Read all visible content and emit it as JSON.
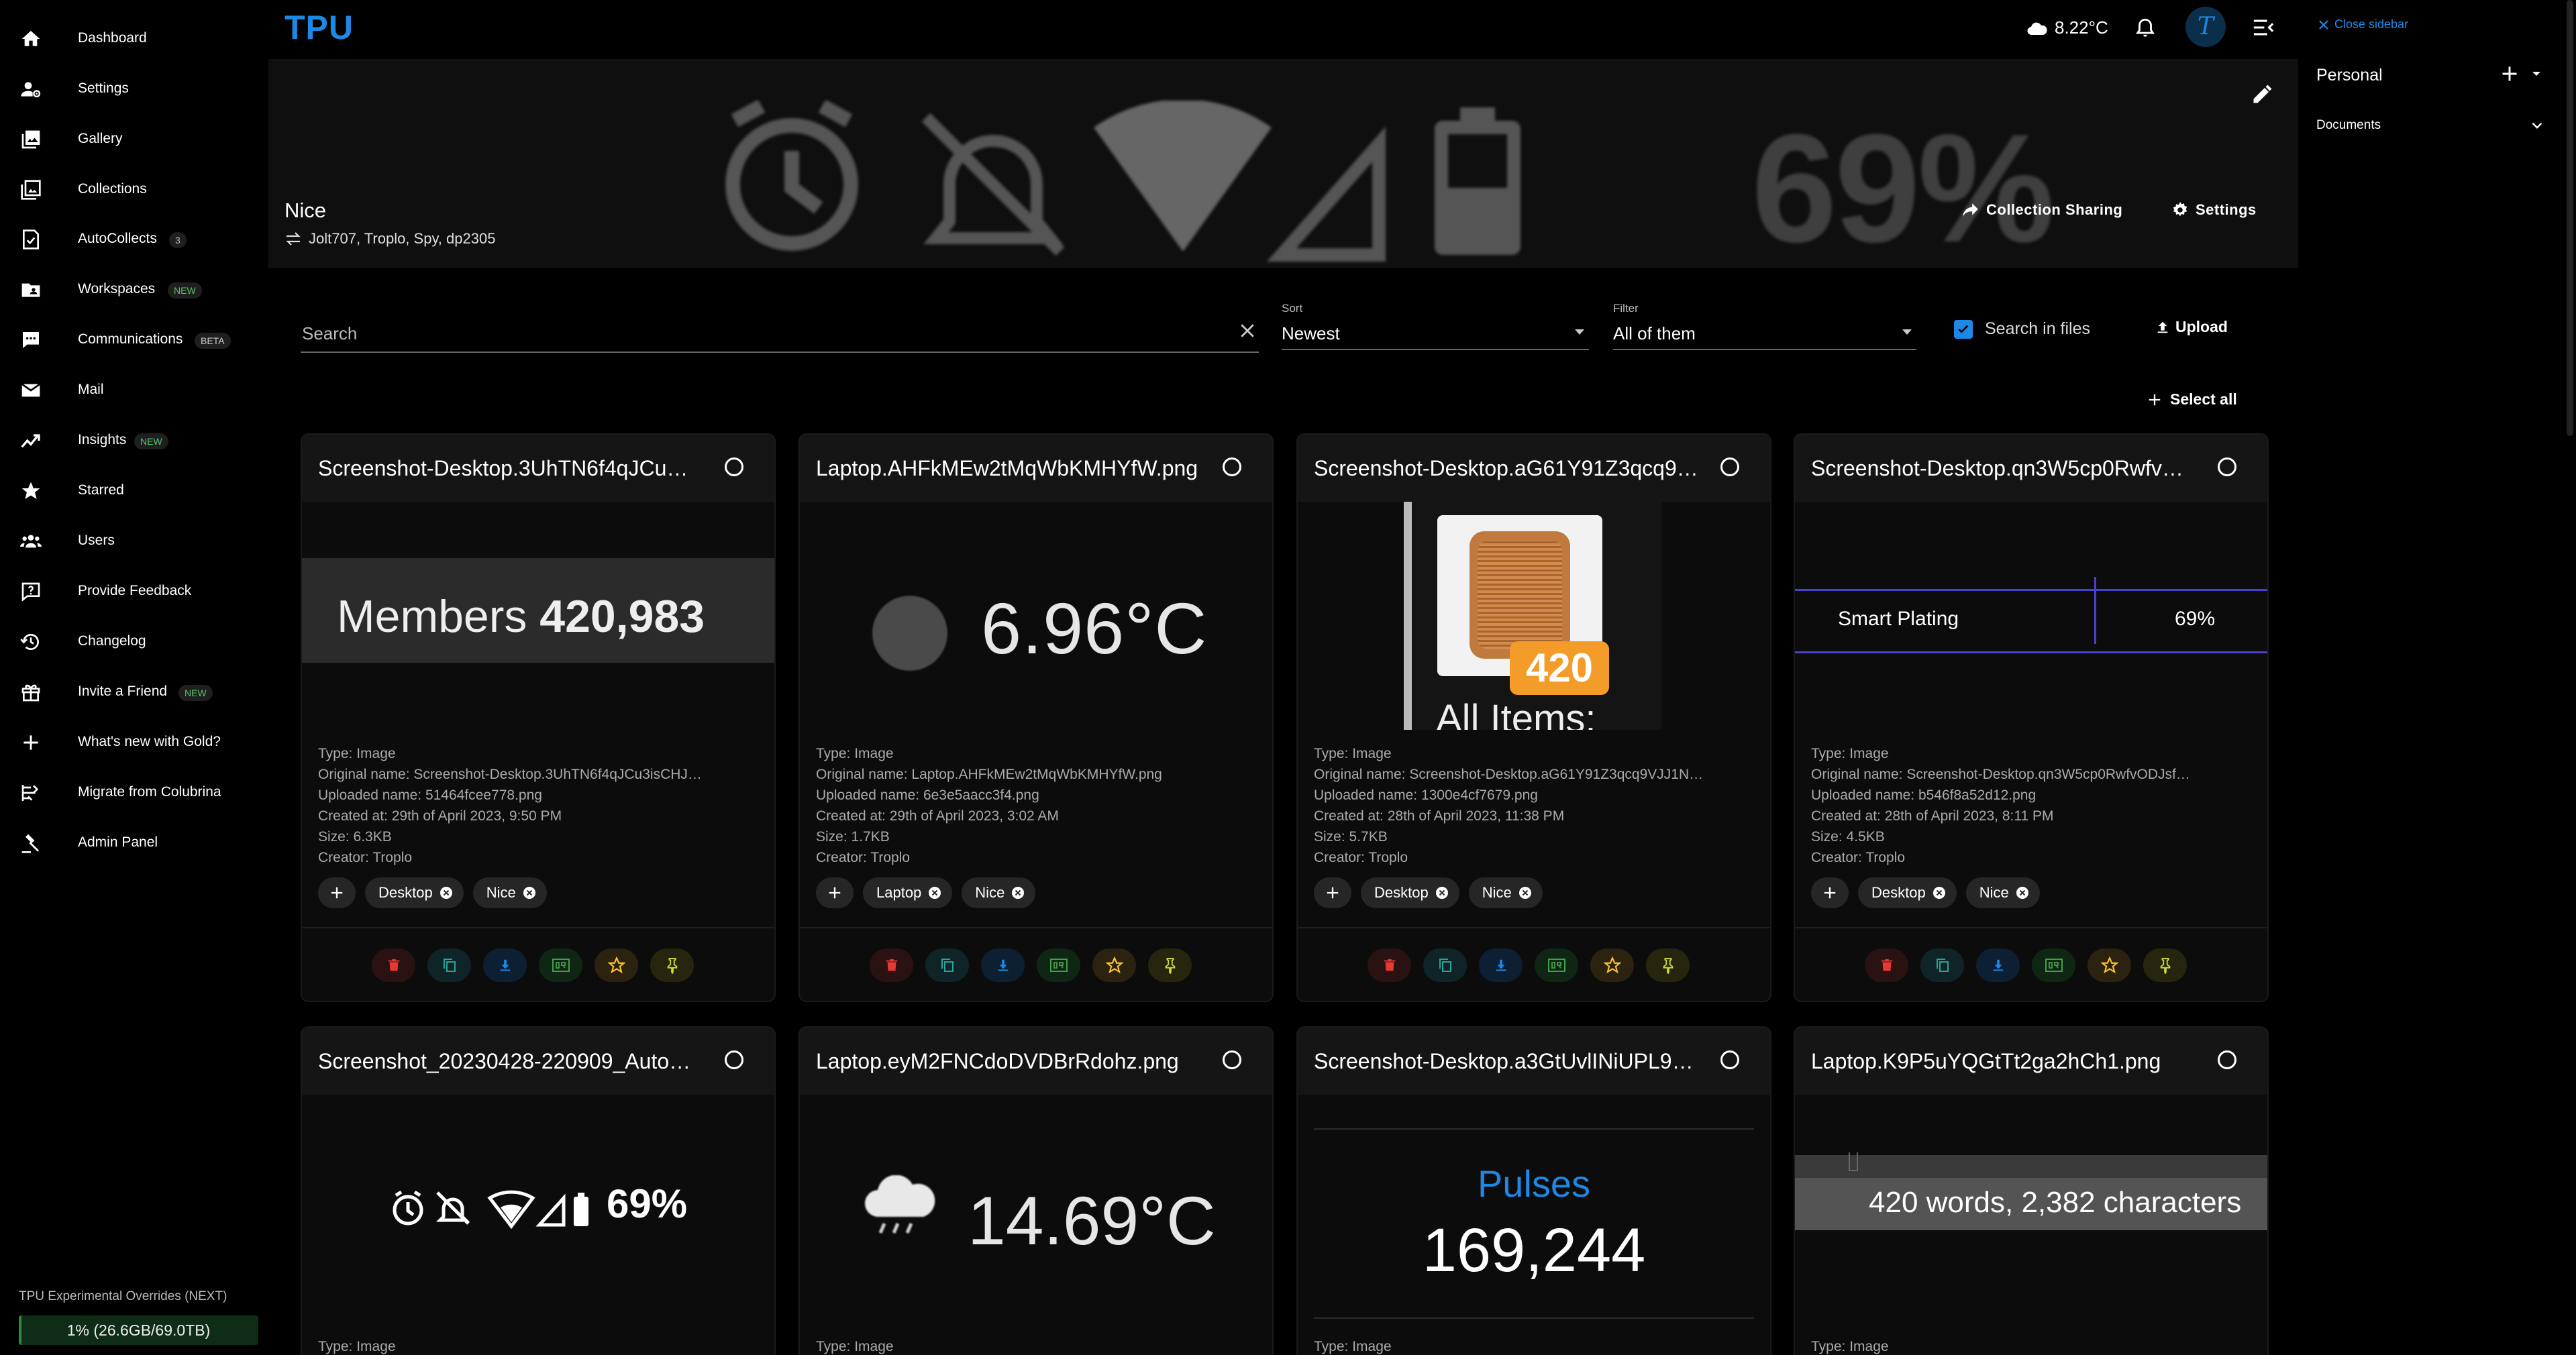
{
  "app": {
    "logo": "TPU"
  },
  "sidebar": {
    "items": [
      {
        "label": "Dashboard"
      },
      {
        "label": "Settings"
      },
      {
        "label": "Gallery"
      },
      {
        "label": "Collections"
      },
      {
        "label": "AutoCollects",
        "badge": "3"
      },
      {
        "label": "Workspaces",
        "badge": "NEW"
      },
      {
        "label": "Communications",
        "badge": "BETA"
      },
      {
        "label": "Mail"
      },
      {
        "label": "Insights",
        "badge": "NEW"
      },
      {
        "label": "Starred"
      },
      {
        "label": "Users"
      },
      {
        "label": "Provide Feedback"
      },
      {
        "label": "Changelog"
      },
      {
        "label": "Invite a Friend",
        "badge": "NEW"
      },
      {
        "label": "What's new with Gold?"
      },
      {
        "label": "Migrate from Colubrina"
      },
      {
        "label": "Admin Panel"
      }
    ],
    "overrides_label": "TPU Experimental Overrides (NEXT)",
    "quota_text": "1% (26.6GB/69.0TB)",
    "quota_percent": 1
  },
  "topbar": {
    "weather_temp": "8.22°C",
    "avatar_letter": "T"
  },
  "right_panel": {
    "close_label": "Close sidebar",
    "personal_label": "Personal",
    "documents_label": "Documents"
  },
  "collection": {
    "title": "Nice",
    "users": "Jolt707, Troplo, Spy, dp2305",
    "banner_text": "69%",
    "sharing_label": "Collection Sharing",
    "settings_label": "Settings"
  },
  "controls": {
    "search_placeholder": "Search",
    "sort_caption": "Sort",
    "sort_value": "Newest",
    "filter_caption": "Filter",
    "filter_value": "All of them",
    "search_in_files_label": "Search in files",
    "upload_label": "Upload",
    "select_all_label": "Select all"
  },
  "cards": [
    {
      "title": "Screenshot-Desktop.3UhTN6f4qJCu…",
      "preview": {
        "label": "Members",
        "value": "420,983"
      },
      "type": "Type: Image",
      "original": "Original name: Screenshot-Desktop.3UhTN6f4qJCu3isCHJ…",
      "uploaded": "Uploaded name: 51464fcee778.png",
      "created": "Created at: 29th of April 2023, 9:50 PM",
      "size": "Size: 6.3KB",
      "creator": "Creator: Troplo",
      "tags": [
        "Desktop",
        "Nice"
      ]
    },
    {
      "title": "Laptop.AHFkMEw2tMqWbKMHYfW.png",
      "preview": {
        "value": "6.96°C"
      },
      "type": "Type: Image",
      "original": "Original name: Laptop.AHFkMEw2tMqWbKMHYfW.png",
      "uploaded": "Uploaded name: 6e3e5aacc3f4.png",
      "created": "Created at: 29th of April 2023, 3:02 AM",
      "size": "Size: 1.7KB",
      "creator": "Creator: Troplo",
      "tags": [
        "Laptop",
        "Nice"
      ]
    },
    {
      "title": "Screenshot-Desktop.aG61Y91Z3qcq9…",
      "preview": {
        "badge": "420",
        "caption": "All Items:"
      },
      "type": "Type: Image",
      "original": "Original name: Screenshot-Desktop.aG61Y91Z3qcq9VJJ1N…",
      "uploaded": "Uploaded name: 1300e4cf7679.png",
      "created": "Created at: 28th of April 2023, 11:38 PM",
      "size": "Size: 5.7KB",
      "creator": "Creator: Troplo",
      "tags": [
        "Desktop",
        "Nice"
      ]
    },
    {
      "title": "Screenshot-Desktop.qn3W5cp0Rwfv…",
      "preview": {
        "label": "Smart Plating",
        "value": "69%"
      },
      "type": "Type: Image",
      "original": "Original name: Screenshot-Desktop.qn3W5cp0RwfvODJsf…",
      "uploaded": "Uploaded name: b546f8a52d12.png",
      "created": "Created at: 28th of April 2023, 8:11 PM",
      "size": "Size: 4.5KB",
      "creator": "Creator: Troplo",
      "tags": [
        "Desktop",
        "Nice"
      ]
    },
    {
      "title": "Screenshot_20230428-220909_Auto…",
      "preview": {
        "value": "69%"
      },
      "type": "Type: Image"
    },
    {
      "title": "Laptop.eyM2FNCdoDVDBrRdohz.png",
      "preview": {
        "value": "14.69°C"
      },
      "type": "Type: Image"
    },
    {
      "title": "Screenshot-Desktop.a3GtUvlINiUPL9…",
      "preview": {
        "label": "Pulses",
        "value": "169,244"
      },
      "type": "Type: Image"
    },
    {
      "title": "Laptop.K9P5uYQGtTt2ga2hCh1.png",
      "preview": {
        "value": "420 words, 2,382 characters"
      },
      "type": "Type: Image"
    }
  ],
  "colors": {
    "accent": "#1e88e5",
    "background": "#000000",
    "card": "#0c0c0c",
    "delete": "#e53935",
    "copy": "#26a69a",
    "download": "#1e88e5",
    "qr": "#43a047",
    "star": "#fbc02d",
    "pin": "#cddc39"
  }
}
